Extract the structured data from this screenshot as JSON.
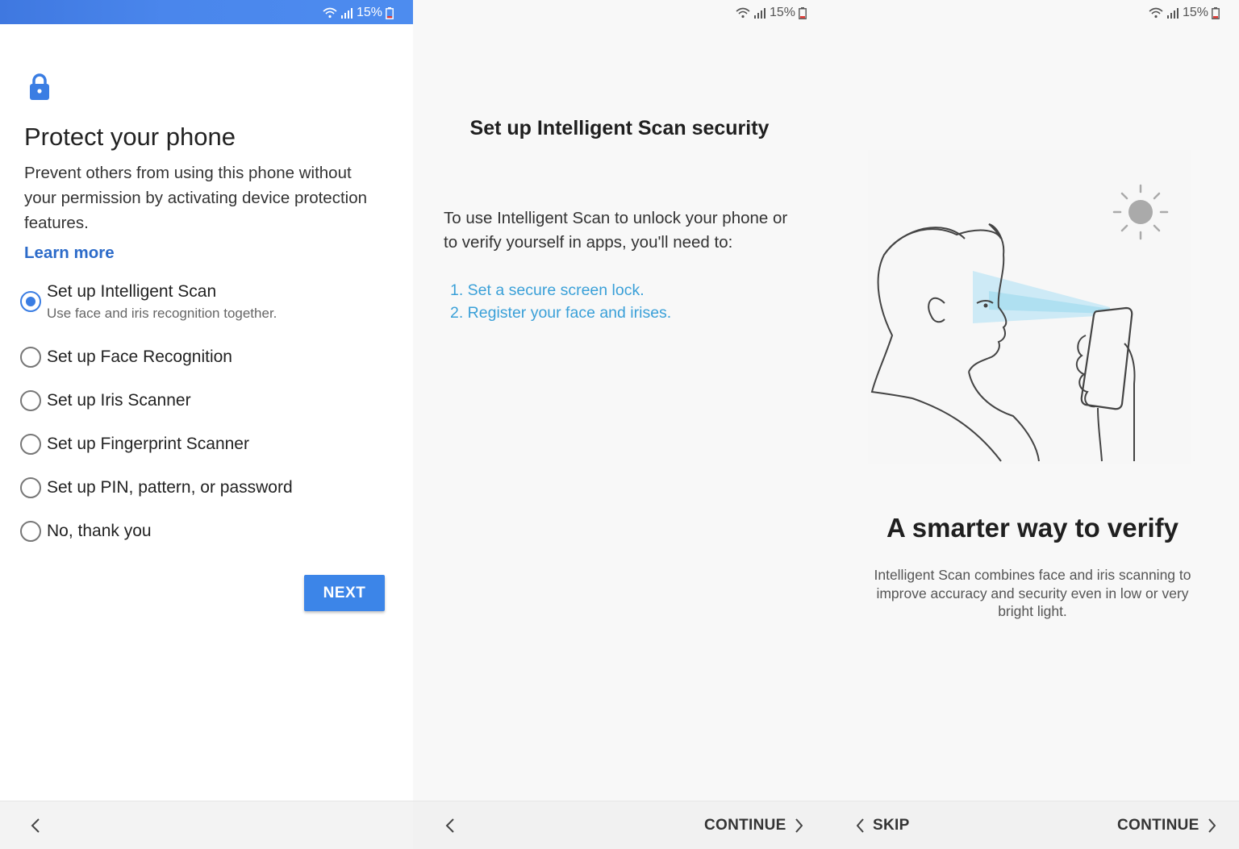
{
  "status_bar": {
    "battery": "15%"
  },
  "screen1": {
    "title": "Protect your phone",
    "description": "Prevent others from using this phone without your permission by activating device protection features.",
    "learn_more": "Learn more",
    "options": [
      {
        "label": "Set up Intelligent Scan",
        "sublabel": "Use face and iris recognition together.",
        "selected": true
      },
      {
        "label": "Set up Face Recognition",
        "selected": false
      },
      {
        "label": "Set up Iris Scanner",
        "selected": false
      },
      {
        "label": "Set up Fingerprint Scanner",
        "selected": false
      },
      {
        "label": "Set up PIN, pattern, or password",
        "selected": false
      },
      {
        "label": "No, thank you",
        "selected": false
      }
    ],
    "next_label": "NEXT"
  },
  "screen2": {
    "title": "Set up Intelligent Scan security",
    "description": "To use Intelligent Scan to unlock your phone or to verify yourself in apps, you'll need to:",
    "steps": [
      "1. Set a secure screen lock.",
      "2. Register your face and irises."
    ],
    "continue_label": "CONTINUE"
  },
  "screen3": {
    "title": "A smarter way to verify",
    "description": "Intelligent Scan combines face and iris scanning to improve accuracy and security even in low or very bright light.",
    "skip_label": "SKIP",
    "continue_label": "CONTINUE"
  },
  "colors": {
    "accent": "#3c85e8",
    "link": "#2c6bc9",
    "step_link": "#3aa0d8",
    "statusbar": "#4a86ec"
  },
  "icons": [
    "wifi-icon",
    "signal-icon",
    "battery-icon",
    "lock-icon",
    "back-icon",
    "chevron-right-icon",
    "sun-icon"
  ]
}
